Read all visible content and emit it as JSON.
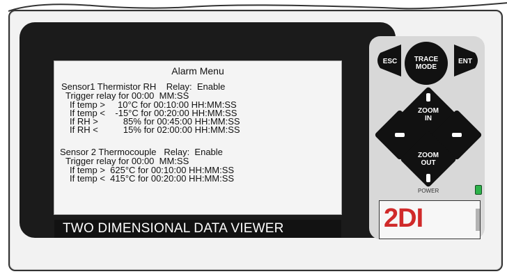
{
  "screen": {
    "title": "Alarm Menu",
    "sensor1": {
      "header": "Sensor1 Thermistor RH    Relay:  Enable",
      "trigger": "Trigger relay for 00:00  MM:SS",
      "rows": [
        "If temp >     10°C for 00:10:00 HH:MM:SS",
        "If temp <    -15°C for 00:20:00 HH:MM:SS",
        "If RH >          85% for 00:45:00 HH:MM:SS",
        "If RH <          15% for 02:00:00 HH:MM:SS"
      ]
    },
    "sensor2": {
      "header": "Sensor 2 Thermocouple   Relay:  Enable",
      "trigger": "Trigger relay for 00:00  MM:SS",
      "rows": [
        "If temp >  625°C for 00:10:00 HH:MM:SS",
        "If temp <  415°C for 00:20:00 HH:MM:SS"
      ]
    }
  },
  "footer": {
    "label": "TWO DIMENSIONAL DATA VIEWER"
  },
  "keypad": {
    "esc": "ESC",
    "trace_mode": "TRACE\nMODE",
    "ent": "ENT",
    "zoom_in": "ZOOM\nIN",
    "zoom_out": "ZOOM\nOUT",
    "power_label": "POWER"
  },
  "logo": {
    "text": "2DI",
    "subtext": ""
  },
  "colors": {
    "accent": "#d02a2a",
    "led": "#2db24a",
    "button": "#111111"
  }
}
